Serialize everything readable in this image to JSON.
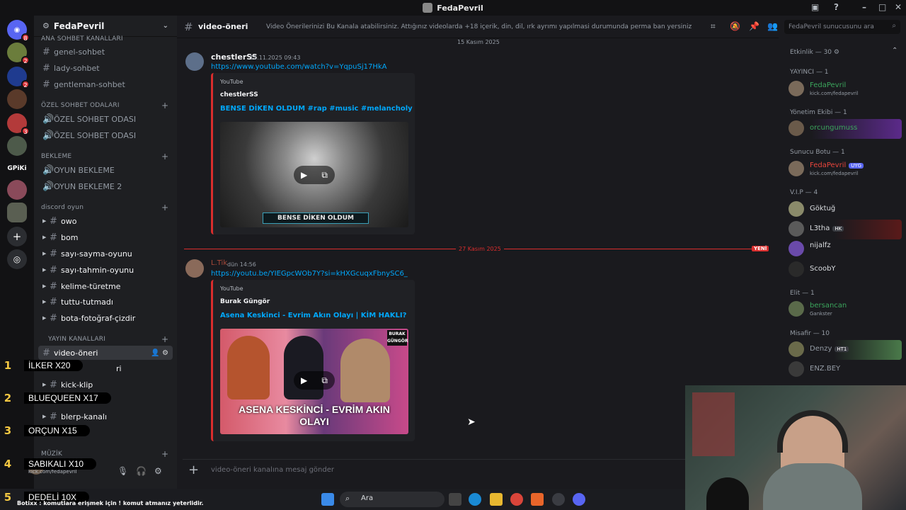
{
  "window": {
    "title": "FedaPevril"
  },
  "rail": {
    "badges": [
      "8",
      "2",
      "2",
      "3"
    ],
    "gpiki_label": "GPiKi"
  },
  "server": {
    "name": "FedaPevril"
  },
  "sidebar": {
    "categories": [
      {
        "label": "ANA SOHBET KANALLARI"
      },
      {
        "label": "ÖZEL SOHBET ODALARI"
      },
      {
        "label": "BEKLEME"
      },
      {
        "label": "discord oyun"
      },
      {
        "label": "YAYIN KANALLARI"
      },
      {
        "label": "MÜZİK"
      }
    ],
    "channels": [
      {
        "label": "genel-sohbet"
      },
      {
        "label": "lady-sohbet"
      },
      {
        "label": "gentleman-sohbet"
      },
      {
        "label": "ÖZEL SOHBET ODASI"
      },
      {
        "label": "ÖZEL SOHBET ODASI"
      },
      {
        "label": "OYUN BEKLEME"
      },
      {
        "label": "OYUN BEKLEME 2"
      },
      {
        "label": "owo"
      },
      {
        "label": "bom"
      },
      {
        "label": "sayı-sayma-oyunu"
      },
      {
        "label": "sayı-tahmin-oyunu"
      },
      {
        "label": "kelime-türetme"
      },
      {
        "label": "tuttu-tutmadı"
      },
      {
        "label": "bota-fotoğraf-çizdir"
      },
      {
        "label": "video-öneri"
      },
      {
        "label": "ri"
      },
      {
        "label": "kick-klip"
      },
      {
        "label": "blerp-kanalı"
      }
    ]
  },
  "user_panel": {
    "sub": "kick.com/fedapevril"
  },
  "channel_header": {
    "name": "video-öneri",
    "topic": "Video Önerilerinizi Bu Kanala atabilirsiniz. Attığınız videolarda +18 içerik, din, dil, ırk ayrımı yapılmasi durumunda perma ban yersiniz",
    "search_placeholder": "FedaPevril sunucusunu ara"
  },
  "messages": [
    {
      "date_divider": "15 Kasım 2025",
      "author": "chestlerSS",
      "time": "15.11.2025 09:43",
      "link": "https://www.youtube.com/watch?v=YqpuSj17HkA",
      "embed": {
        "provider": "YouTube",
        "author": "chestlerSS",
        "title": "BENSE DİKEN OLDUM #rap #music #melancholy",
        "thumb_caption": "BENSE DİKEN OLDUM"
      }
    },
    {
      "date_divider": "27 Kasım 2025",
      "new_label": "YENİ",
      "author": "L.Tik",
      "time": "dün 14:56",
      "link": "https://youtu.be/YIEGpcWOb7Y?si=kHXGcuqxFbnySC6_",
      "embed": {
        "provider": "YouTube",
        "author": "Burak Güngör",
        "title": "Asena Keskinci - Evrim Akın Olayı | KİM HAKLI?",
        "thumb_caption": "ASENA KESKİNCİ - EVRİM AKIN OLAYI",
        "thumb_logo": "BURAK GÜNGÖR"
      }
    }
  ],
  "composer": {
    "placeholder": "video-öneri kanalına mesaj gönder"
  },
  "members": {
    "header": "Etkinlik — 30",
    "groups": [
      {
        "label": "YAYINCI — 1",
        "members": [
          {
            "name": "FedaPevril",
            "sub": "kick.com/fedapevril",
            "color": "#3ba55c"
          }
        ]
      },
      {
        "label": "Yönetim Ekibi — 1",
        "members": [
          {
            "name": "orcungumuss",
            "sub": "",
            "color": "#3ba55c"
          }
        ]
      },
      {
        "label": "Sunucu Botu — 1",
        "members": [
          {
            "name": "FedaPevril",
            "sub": "kick.com/fedapevril",
            "tag": "UYG",
            "color": "#e8453c"
          }
        ]
      },
      {
        "label": "V.I.P — 4",
        "members": [
          {
            "name": "Göktuğ",
            "sub": "",
            "color": "#dbdee1"
          },
          {
            "name": "L3tha",
            "sub": "",
            "tag": "HK",
            "color": "#dbdee1"
          },
          {
            "name": "nijalfz",
            "sub": "",
            "color": "#dbdee1"
          },
          {
            "name": "ScoobY",
            "sub": "",
            "color": "#dbdee1"
          }
        ]
      },
      {
        "label": "Elit — 1",
        "members": [
          {
            "name": "bersancan",
            "sub": "Gankster",
            "color": "#3ba55c"
          }
        ]
      },
      {
        "label": "Misafir — 10",
        "members": [
          {
            "name": "Denzy",
            "sub": "",
            "tag": "HT1",
            "color": "#949ba4"
          },
          {
            "name": "ENZ.BEY",
            "sub": "",
            "color": "#949ba4"
          }
        ]
      }
    ]
  },
  "overlay_leaderboard": [
    {
      "rank": "1",
      "text": "İLKER X20"
    },
    {
      "rank": "2",
      "text": "BLUEQUEEN X17"
    },
    {
      "rank": "3",
      "text": "ORÇUN X15"
    },
    {
      "rank": "4",
      "text": "SABIKALI X10"
    },
    {
      "rank": "5",
      "text": "DEDELİ 10X"
    }
  ],
  "bottom_line": "Botixx : komutlara erişmek için ! komut atmanız yeterlidir.",
  "taskbar": {
    "search_label": "Ara"
  },
  "colors": {
    "accent_red": "#da2d2d",
    "link": "#00a8fc",
    "online": "#3ba55c"
  }
}
